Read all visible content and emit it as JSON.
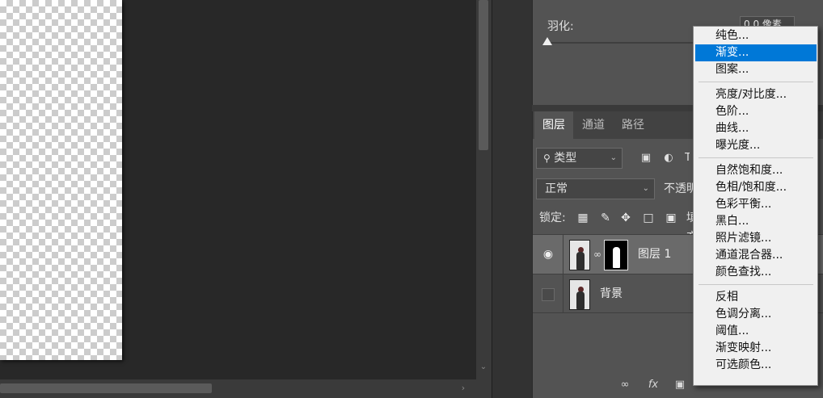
{
  "properties": {
    "feather_label": "羽化:",
    "feather_value": "0.0 像素",
    "feather_level": 0
  },
  "layers_panel": {
    "tabs": [
      {
        "label": "图层",
        "active": true
      },
      {
        "label": "通道",
        "active": false
      },
      {
        "label": "路径",
        "active": false
      }
    ],
    "filter_type": "类型",
    "blend_mode": "正常",
    "opacity_label": "不透明度:",
    "lock_label": "锁定:",
    "fill_label": "填充:",
    "layers": [
      {
        "name": "图层 1",
        "visible": true,
        "selected": true,
        "has_mask": true
      },
      {
        "name": "背景",
        "visible": false,
        "selected": false,
        "has_mask": false
      }
    ],
    "footer_icons": [
      "link-icon",
      "fx-icon",
      "mask-icon",
      "adjustment-icon",
      "group-icon",
      "new-layer-icon",
      "trash-icon"
    ]
  },
  "adjustment_menu": {
    "groups": [
      [
        {
          "label": "纯色..."
        },
        {
          "label": "渐变...",
          "highlighted": true
        },
        {
          "label": "图案..."
        }
      ],
      [
        {
          "label": "亮度/对比度..."
        },
        {
          "label": "色阶..."
        },
        {
          "label": "曲线..."
        },
        {
          "label": "曝光度..."
        }
      ],
      [
        {
          "label": "自然饱和度..."
        },
        {
          "label": "色相/饱和度..."
        },
        {
          "label": "色彩平衡..."
        },
        {
          "label": "黑白..."
        },
        {
          "label": "照片滤镜..."
        },
        {
          "label": "通道混合器..."
        },
        {
          "label": "颜色查找..."
        }
      ],
      [
        {
          "label": "反相"
        },
        {
          "label": "色调分离..."
        },
        {
          "label": "阈值..."
        },
        {
          "label": "渐变映射..."
        },
        {
          "label": "可选颜色..."
        }
      ]
    ]
  },
  "colors": {
    "menu_highlight": "#0078d7",
    "panel_bg": "#535353",
    "canvas_bg": "#282828"
  }
}
